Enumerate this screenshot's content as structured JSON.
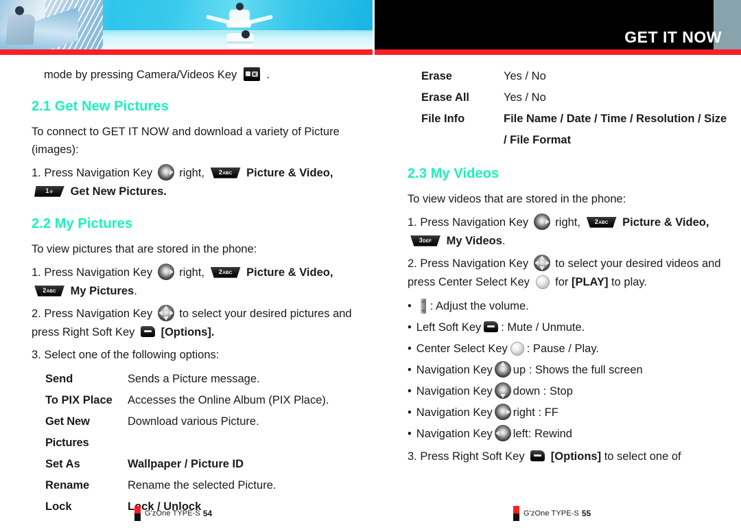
{
  "header": {
    "title": "GET IT NOW",
    "banner_alt": "photo collage of businessman on escalator, martial artists and man on beach",
    "accent_red": "#fa1e28",
    "gray_block": "#88a3ab",
    "heading_color": "#19f2bd"
  },
  "left_column": {
    "continued_line": {
      "before": "mode by pressing Camera/Videos Key",
      "icon": "camera-videos-key-icon",
      "after": "."
    },
    "section_2_1": {
      "heading": "2.1 Get New Pictures",
      "intro": "To connect to GET IT NOW and download a variety of Picture (images):",
      "step1": {
        "number": "1.",
        "t1": "Press Navigation Key",
        "icon1": "navigation-key-right-icon",
        "t2": "right,",
        "icon2": "key-2-abc-icon",
        "t3": "Picture & Video,",
        "icon3": "key-1-icon",
        "t4": "Get New Pictures."
      }
    },
    "section_2_2": {
      "heading": "2.2 My Pictures",
      "intro": "To view pictures that are stored in the phone:",
      "step1": {
        "number": "1.",
        "t1": "Press Navigation Key",
        "icon1": "navigation-key-right-icon",
        "t2": "right,",
        "icon2": "key-2-abc-icon",
        "t3": "Picture & Video,",
        "icon3": "key-2-abc-icon",
        "t4": "My Pictures",
        "t5": "."
      },
      "step2": {
        "number": "2.",
        "t1": "Press Navigation Key",
        "icon1": "navigation-key-all-icon",
        "t2": "to select your desired pictures and press Right Soft Key",
        "icon2": "right-soft-key-icon",
        "t3": "[Options]."
      },
      "step3": {
        "number": "3.",
        "t1": "Select one of the following options:"
      },
      "options": [
        {
          "term": "Send",
          "desc": "Sends a Picture message.",
          "desc_bold": false
        },
        {
          "term": "To PIX Place",
          "desc": "Accesses the Online Album (PIX Place).",
          "desc_bold": false
        },
        {
          "term": "Get New Pictures",
          "desc": "Download various Picture.",
          "desc_bold": false
        },
        {
          "term": "Set As",
          "desc": "Wallpaper / Picture ID",
          "desc_bold": true
        },
        {
          "term": "Rename",
          "desc": "Rename the selected Picture.",
          "desc_bold": false
        },
        {
          "term": "Lock",
          "desc": "Lock / Unlock",
          "desc_bold": true
        }
      ]
    },
    "footer": {
      "mark": "red-black-mark",
      "text": "G'zOne TYPE-S",
      "page": "54"
    }
  },
  "right_column": {
    "options_continued": [
      {
        "term": "Erase",
        "desc": "Yes / No",
        "desc_bold": false
      },
      {
        "term": "Erase All",
        "desc": "Yes / No",
        "desc_bold": false
      },
      {
        "term": "File Info",
        "desc": "File Name / Date / Time / Resolution / Size / File Format",
        "desc_bold": true
      }
    ],
    "section_2_3": {
      "heading": "2.3 My Videos",
      "intro": "To view videos that are stored in the phone:",
      "step1": {
        "number": "1.",
        "t1": "Press Navigation Key",
        "icon1": "navigation-key-right-icon",
        "t2": "right,",
        "icon2": "key-2-abc-icon",
        "t3": "Picture & Video,",
        "icon3": "key-3-def-icon",
        "t4": "My Videos",
        "t5": "."
      },
      "step2": {
        "number": "2.",
        "t1": "Press Navigation Key",
        "icon1": "navigation-key-all-icon",
        "t2": "to select your desired videos and press Center Select Key",
        "icon2": "center-select-key-icon",
        "t3": "for",
        "t4": "[PLAY]",
        "t5": "to play."
      },
      "controls": [
        {
          "label": "",
          "icon": "volume-side-key-icon",
          "text": ": Adjust the volume."
        },
        {
          "label": "Left Soft Key",
          "icon": "left-soft-key-icon",
          "text": ": Mute / Unmute."
        },
        {
          "label": "Center Select Key",
          "icon": "center-select-key-icon",
          "text": ": Pause / Play."
        },
        {
          "label": "Navigation Key",
          "icon": "navigation-key-up-icon",
          "text": "up : Shows the full screen"
        },
        {
          "label": "Navigation Key",
          "icon": "navigation-key-down-icon",
          "text": "down : Stop"
        },
        {
          "label": "Navigation Key",
          "icon": "navigation-key-right-icon",
          "text": "right : FF"
        },
        {
          "label": "Navigation Key",
          "icon": "navigation-key-left-icon",
          "text": "left: Rewind"
        }
      ],
      "step3": {
        "number": "3.",
        "t1": "Press Right Soft Key",
        "icon1": "right-soft-key-icon",
        "t2": "[Options]",
        "t3": "to select one of"
      }
    },
    "footer": {
      "mark": "red-black-mark",
      "text": "G'zOne TYPE-S",
      "page": "55"
    }
  }
}
